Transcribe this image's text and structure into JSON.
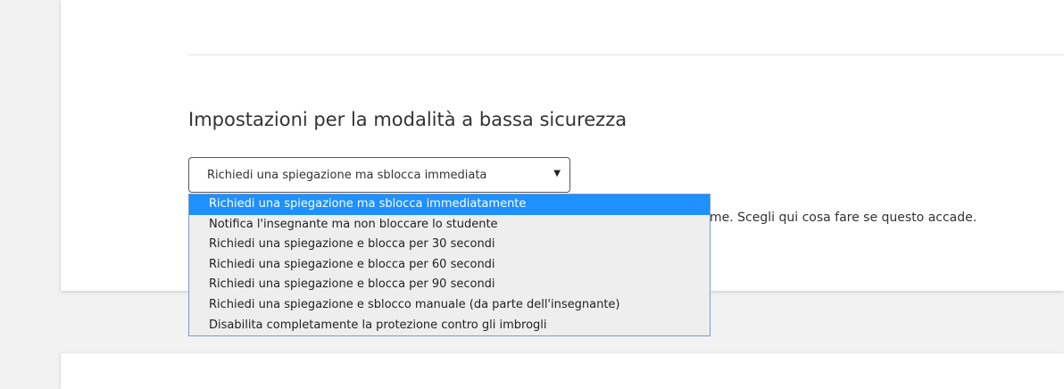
{
  "section": {
    "title": "Impostazioni per la modalità a bassa sicurezza",
    "description_visible_fragment": "me. Scegli qui cosa fare se questo accade."
  },
  "select": {
    "current_value": "Richiedi una spiegazione ma sblocca immediata",
    "caret": "▼",
    "options": [
      "Richiedi una spiegazione ma sblocca immediatamente",
      "Notifica l'insegnante ma non bloccare lo studente",
      "Richiedi una spiegazione e blocca per 30 secondi",
      "Richiedi una spiegazione e blocca per 60 secondi",
      "Richiedi una spiegazione e blocca per 90 secondi",
      "Richiedi una spiegazione e sblocco manuale (da parte dell'insegnante)",
      "Disabilita completamente la protezione contro gli imbrogli"
    ],
    "highlighted_index": 0
  },
  "colors": {
    "highlight": "#1e90ff",
    "dropdown_bg": "#eeeeee",
    "page_bg": "#f2f2f2",
    "card_bg": "#ffffff"
  }
}
